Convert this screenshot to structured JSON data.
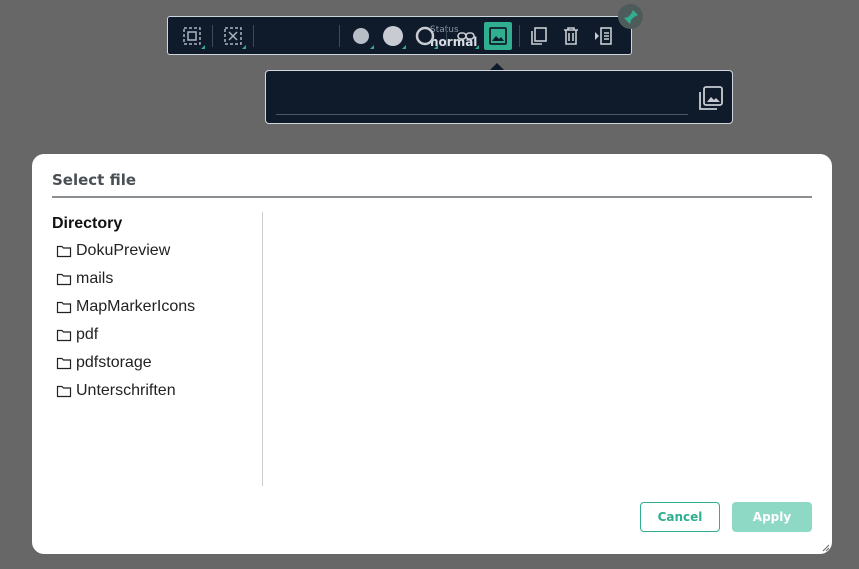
{
  "toolbar": {
    "status_label": "Status",
    "status_value": "normal",
    "buttons": [
      "select-area-icon",
      "deselect-icon",
      "fill-dot-icon",
      "fill-circle-icon",
      "ring-icon",
      "link-icon",
      "image-icon",
      "copy-icon",
      "trash-icon",
      "insert-right-icon"
    ],
    "accent_color": "#2fae90",
    "background_color": "#0f1a2b"
  },
  "popup": {
    "input_value": "",
    "icon": "image-library-icon"
  },
  "dialog": {
    "title": "Select file",
    "directory_heading": "Directory",
    "folders": [
      {
        "label": "DokuPreview"
      },
      {
        "label": "mails"
      },
      {
        "label": "MapMarkerIcons"
      },
      {
        "label": "pdf"
      },
      {
        "label": "pdfstorage"
      },
      {
        "label": "Unterschriften"
      }
    ],
    "cancel_label": "Cancel",
    "apply_label": "Apply"
  }
}
